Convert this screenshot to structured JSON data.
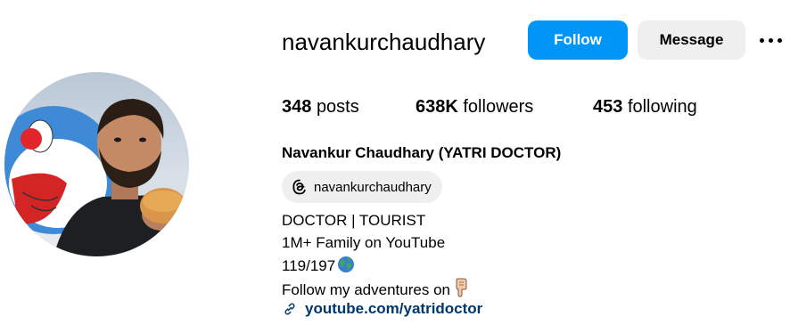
{
  "profile": {
    "username": "navankurchaudhary",
    "full_name": "Navankur Chaudhary (YATRI DOCTOR)",
    "avatar_alt": "profile-photo"
  },
  "actions": {
    "follow_label": "Follow",
    "message_label": "Message"
  },
  "stats": {
    "posts_count": "348",
    "posts_label": "posts",
    "followers_count": "638K",
    "followers_label": "followers",
    "following_count": "453",
    "following_label": "following"
  },
  "threads": {
    "handle": "navankurchaudhary"
  },
  "bio": {
    "line1": "DOCTOR | TOURIST",
    "line2": "1M+ Family on YouTube",
    "line3": "119/197",
    "line4": "Follow my adventures on"
  },
  "link": {
    "url_text": "youtube.com/yatridoctor"
  },
  "colors": {
    "follow_button": "#0095f6",
    "secondary_button": "#efefef",
    "link": "#00376b"
  },
  "icons": {
    "threads": "threads-icon",
    "globe": "globe-emoji-icon",
    "pointing_down": "pointing-down-emoji-icon",
    "link": "link-icon",
    "more": "more-options-icon"
  }
}
